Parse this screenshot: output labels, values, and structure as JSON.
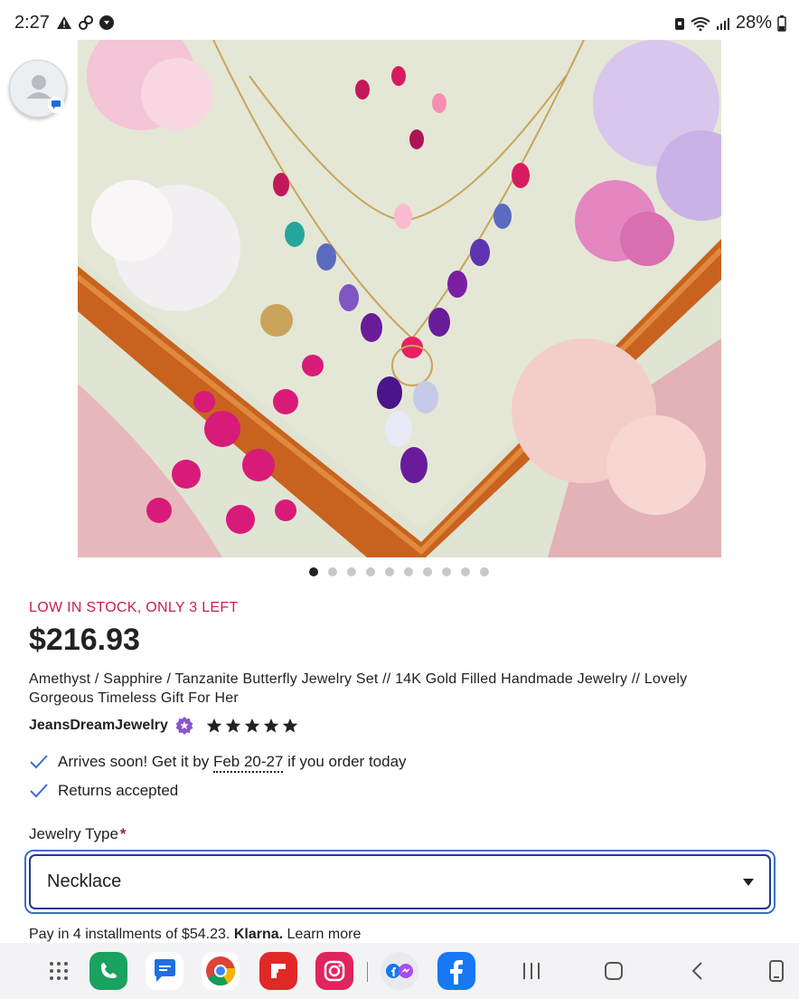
{
  "status_bar": {
    "time": "2:27",
    "battery": "28%"
  },
  "pagination": {
    "total": 10,
    "active": 1
  },
  "product": {
    "stock_note": "LOW IN STOCK, ONLY 3 LEFT",
    "price": "$216.93",
    "title": "Amethyst / Sapphire / Tanzanite Butterfly Jewelry Set // 14K Gold Filled Handmade Jewelry // Lovely Gorgeous Timeless Gift For Her",
    "shop_name": "JeansDreamJewelry",
    "rating": 5
  },
  "delivery": {
    "arrival_prefix": "Arrives soon! Get it by ",
    "arrival_dates": "Feb 20-27",
    "arrival_suffix": " if you order today",
    "returns": "Returns accepted"
  },
  "variation": {
    "label": "Jewelry Type",
    "required_mark": "*",
    "selected": "Necklace"
  },
  "payment": {
    "text": "Pay in 4 installments of $54.23.",
    "brand": "Klarna.",
    "link": "Learn more"
  },
  "colors": {
    "stock_red": "#c81e4b",
    "accent_blue": "#3a6fc6",
    "check_blue": "#3b6fd4",
    "star_badge": "#8a55c9"
  },
  "nav_apps": [
    "apps-grid-icon",
    "phone-app-icon",
    "messages-app-icon",
    "chrome-app-icon",
    "flipboard-app-icon",
    "instagram-app-icon",
    "facebook-messenger-pair-icon",
    "facebook-app-icon"
  ]
}
